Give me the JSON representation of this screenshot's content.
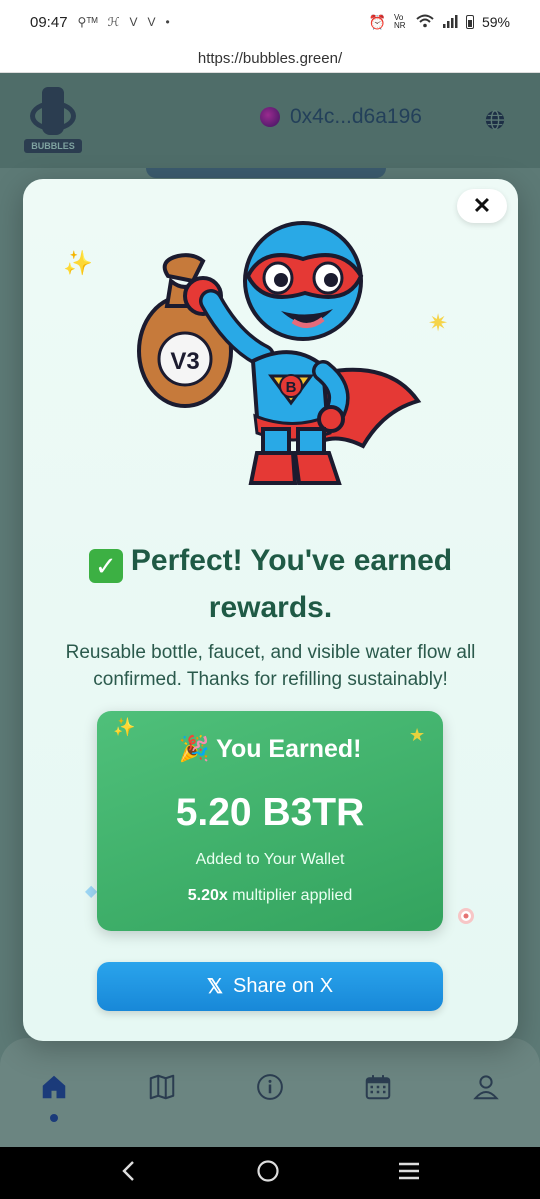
{
  "status_bar": {
    "time": "09:47",
    "notification_glyphs": [
      "⚲ᵀᴹ",
      "ℋ",
      "V",
      "V",
      "•"
    ],
    "battery": "59%",
    "signal_label": "Vo NR"
  },
  "browser": {
    "url": "https://bubbles.green/"
  },
  "app": {
    "logo_text": "BUBBLES",
    "wallet_address": "0x4c...d6a196",
    "nav": [
      "home-icon",
      "map-icon",
      "info-icon",
      "calendar-icon",
      "profile-icon"
    ],
    "active_nav_index": 0
  },
  "modal": {
    "close_label": "✕",
    "headline": "Perfect! You've earned rewards.",
    "check_glyph": "✓",
    "description": "Reusable bottle, faucet, and visible water flow all confirmed. Thanks for refilling sustainably!",
    "card": {
      "title": "You Earned!",
      "party_glyph": "🎉",
      "amount": "5.20 B3TR",
      "subtitle": "Added to Your Wallet",
      "multiplier_value": "5.20x",
      "multiplier_text": " multiplier applied"
    },
    "share_label": "Share on X",
    "share_icon_glyph": "𝕏",
    "mascot_bag_text": "V3",
    "mascot_badge_text": "B"
  },
  "colors": {
    "card_green": "#3fae68",
    "share_blue": "#1e93e0",
    "headline_green": "#1f5a45",
    "modal_bg": "#eaf9f4"
  }
}
